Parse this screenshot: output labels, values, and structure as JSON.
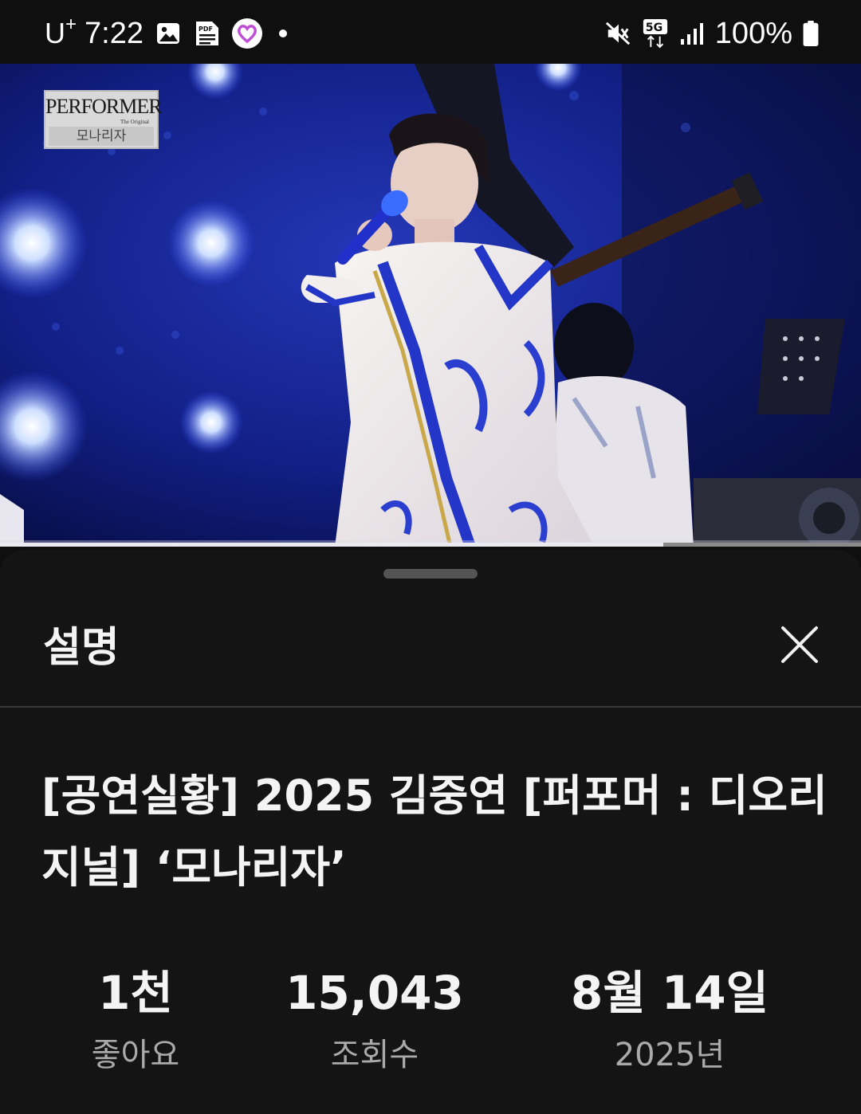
{
  "status_bar": {
    "carrier": "U",
    "carrier_sup": "+",
    "time": "7:22",
    "network": "5G",
    "battery": "100%",
    "icons": [
      "gallery-icon",
      "pdf-icon",
      "heart-app-icon",
      "notification-dot",
      "mute-icon",
      "5g-icon",
      "signal-icon",
      "battery-icon"
    ]
  },
  "video": {
    "logo_text": "PERFORMER",
    "logo_sub": "The Original",
    "logo_kr": "모나리자",
    "progress": 0.77
  },
  "sheet": {
    "title": "설명",
    "video_title": "[공연실황] 2025 김중연 [퍼포머 : 디오리지널] ‘모나리자’",
    "stats": {
      "likes_value": "1천",
      "likes_label": "좋아요",
      "views_value": "15,043",
      "views_label": "조회수",
      "date_value": "8월 14일",
      "date_label": "2025년"
    }
  },
  "colors": {
    "background": "#0f0f0f",
    "sheet": "#141414",
    "text": "#f1f1f1",
    "secondary_text": "#aaaaaa",
    "stage_blue": "#1a2a9a"
  }
}
